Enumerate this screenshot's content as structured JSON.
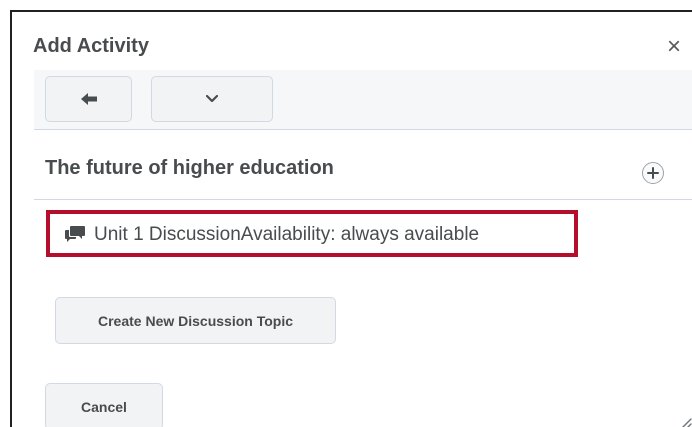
{
  "dialog": {
    "title": "Add Activity",
    "close_label": "×"
  },
  "toolbar": {
    "back_icon": "back-arrow-icon",
    "menu_icon": "chevron-down-icon"
  },
  "section": {
    "title": "The future of higher education",
    "add_icon": "plus-circle-icon"
  },
  "topic": {
    "icon": "discussion-icon",
    "text": "Unit 1 DiscussionAvailability: always available",
    "highlight_color": "#b50d2b"
  },
  "actions": {
    "create_label": "Create New Discussion Topic",
    "cancel_label": "Cancel"
  }
}
